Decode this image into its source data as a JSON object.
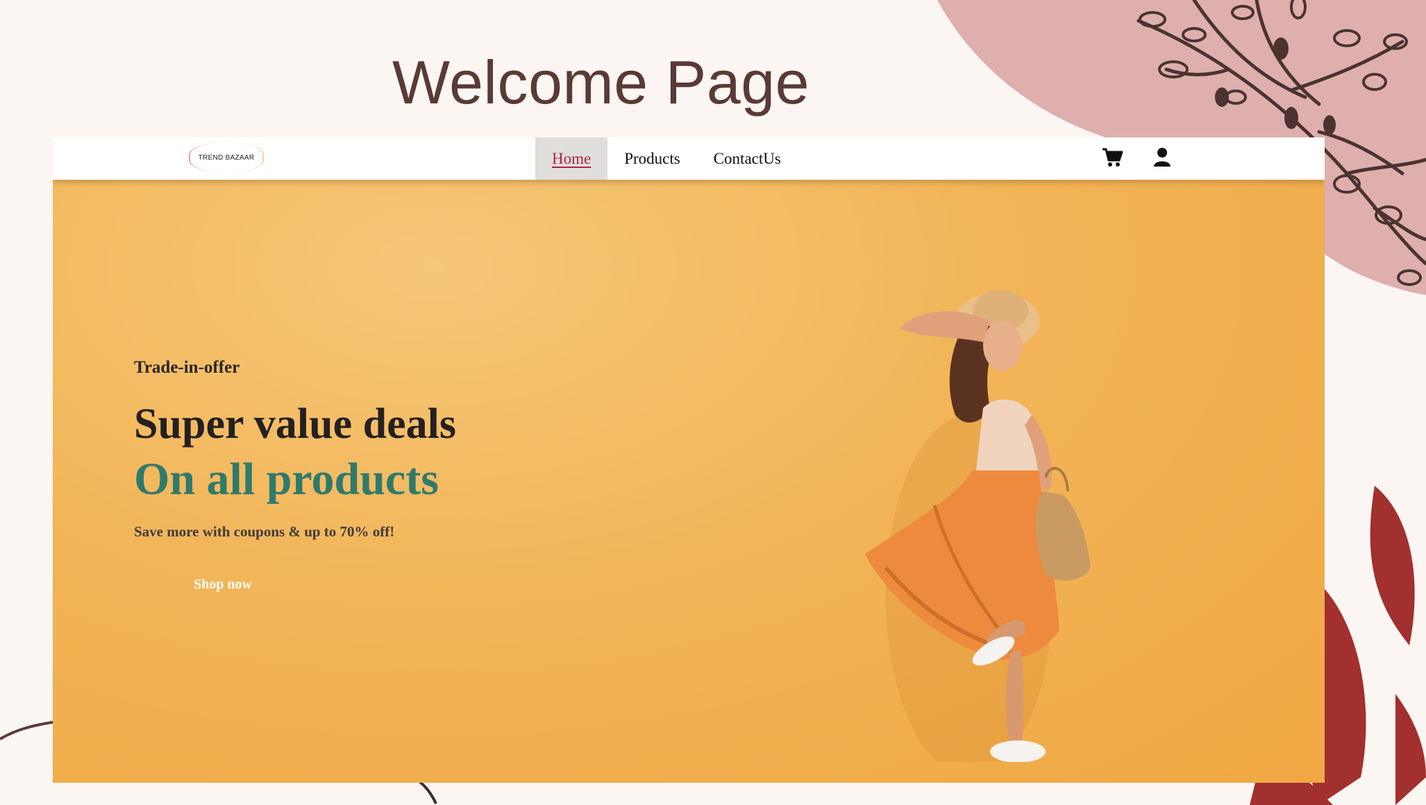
{
  "slide": {
    "title": "Welcome Page"
  },
  "site": {
    "logo_text": "TREND BAZAAR",
    "nav": [
      {
        "label": "Home",
        "active": true
      },
      {
        "label": "Products",
        "active": false
      },
      {
        "label": "ContactUs",
        "active": false
      }
    ],
    "icons": {
      "cart": "cart-icon",
      "user": "user-icon"
    }
  },
  "hero": {
    "kicker": "Trade-in-offer",
    "headline": "Super value deals",
    "subheadline": "On all products",
    "promo": "Save more with coupons & up to 70% off!",
    "cta": "Shop now"
  },
  "colors": {
    "accent_teal": "#2f7a6c",
    "hero_bg": "#f2b558",
    "active_link": "#b0263d",
    "slide_title": "#5a3a34",
    "decor_pink": "#deafad",
    "decor_red": "#a2302f"
  }
}
